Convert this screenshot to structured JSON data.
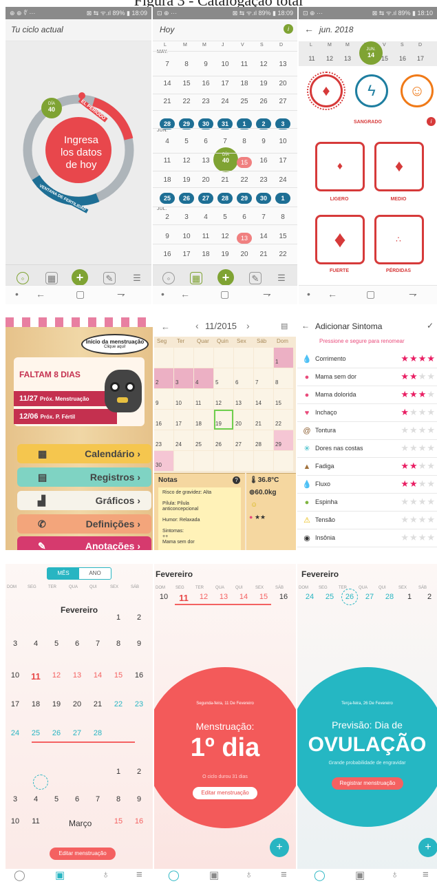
{
  "caption": "Figura 3 - Catalogação total",
  "p1": {
    "status_left": "⊕ ⊕ ∜ ···",
    "status_right": "⊠ ⇆ ᯤ.ıl 89% ▮ 18:09",
    "title": "Tu ciclo actual",
    "day_label": "DÍA",
    "day_num": "40",
    "periodo": "EL PERÍODO",
    "ventana": "VENTANA DE FERTILIDAD",
    "center_text": [
      "Ingresa",
      "los datos",
      "de hoy"
    ]
  },
  "p2": {
    "status_left": "⊡ ⊕ ···",
    "status_right": "⊠ ⇆ ᯤ.ıl 89% ▮ 18:09",
    "title": "Hoy",
    "weekdays": [
      "L",
      "M",
      "M",
      "J",
      "V",
      "S",
      "D"
    ],
    "month_may": "MAY.",
    "month_jun": "JUN.",
    "month_jul": "JUL.",
    "rows": [
      [
        "7",
        "8",
        "9",
        "10",
        "11",
        "12",
        "13"
      ],
      [
        "14",
        "15",
        "16",
        "17",
        "18",
        "19",
        "20"
      ],
      [
        "21",
        "22",
        "23",
        "24",
        "25",
        "26",
        "27"
      ],
      [
        "28",
        "29",
        "30",
        "31",
        "1",
        "2",
        "3"
      ],
      [
        "4",
        "5",
        "6",
        "7",
        "8",
        "9",
        "10"
      ],
      [
        "11",
        "12",
        "13",
        "40",
        "15",
        "16",
        "17"
      ],
      [
        "18",
        "19",
        "20",
        "21",
        "22",
        "23",
        "24"
      ],
      [
        "25",
        "26",
        "27",
        "28",
        "29",
        "30",
        "1"
      ],
      [
        "2",
        "3",
        "4",
        "5",
        "6",
        "7",
        "8"
      ],
      [
        "9",
        "10",
        "11",
        "12",
        "13",
        "14",
        "15"
      ],
      [
        "16",
        "17",
        "18",
        "19",
        "20",
        "21",
        "22"
      ]
    ],
    "dia_label": "DÍA",
    "jul_small": "JUL."
  },
  "p3": {
    "status_left": "⊡ ⊕ ···",
    "status_right": "⊠ ⇆ ᯤ.ıl 89% ▮ 18:10",
    "title": "jun. 2018",
    "weekdays": [
      "L",
      "M",
      "M",
      "J",
      "V",
      "S",
      "D"
    ],
    "days": [
      "11",
      "12",
      "13",
      "14",
      "15",
      "16",
      "17"
    ],
    "jun_label": "JUN.",
    "sangrado": "SANGRADO",
    "cards": [
      "LIGERO",
      "MEDIO",
      "FUERTE",
      "PÉRDIDAS"
    ]
  },
  "m1": {
    "bubble1": "Início da menstruação",
    "bubble2": "Clique aqui!",
    "faltam": "FALTAM 8 DIAS",
    "prox1_date": "11/27",
    "prox1_label": "Próx. Menstruação",
    "prox2_date": "12/06",
    "prox2_label": "Próx. P. Fértil",
    "menu": [
      "Calendário",
      "Registros",
      "Gráficos",
      "Definições",
      "Anotações"
    ]
  },
  "m2": {
    "month": "11/2015",
    "weekdays": [
      "Seg",
      "Ter",
      "Quar",
      "Quin",
      "Sex",
      "Sáb",
      "Dom"
    ],
    "rows": [
      [
        "",
        "",
        "",
        "",
        "",
        "",
        "1"
      ],
      [
        "2",
        "3",
        "4",
        "5",
        "6",
        "7",
        "8"
      ],
      [
        "9",
        "10",
        "11",
        "12",
        "13",
        "14",
        "15"
      ],
      [
        "16",
        "17",
        "18",
        "19",
        "20",
        "21",
        "22"
      ],
      [
        "23",
        "24",
        "25",
        "26",
        "27",
        "28",
        "29"
      ],
      [
        "30",
        "",
        "",
        "",
        "",
        "",
        ""
      ]
    ],
    "notas": "Notas",
    "temp": "36.8°C",
    "weight": "60.0kg",
    "stars": "★★",
    "note_lines": [
      "Risco de gravidez: Alta",
      "",
      "Pílula: Pílula",
      "anticoncepcional",
      "",
      "Humor: Relaxada",
      "",
      "Sintomas:",
      "++",
      "Mama sem dor"
    ]
  },
  "m3": {
    "title": "Adicionar Sintoma",
    "hint": "Pressione e segure para renomear",
    "items": [
      {
        "icon": "💧",
        "name": "Corrimento",
        "stars": 4
      },
      {
        "icon": "●",
        "name": "Mama sem dor",
        "stars": 2
      },
      {
        "icon": "●",
        "name": "Mama dolorida",
        "stars": 3
      },
      {
        "icon": "♥",
        "name": "Inchaço",
        "stars": 1
      },
      {
        "icon": "@",
        "name": "Tontura",
        "stars": 0
      },
      {
        "icon": "✳",
        "name": "Dores nas costas",
        "stars": 0
      },
      {
        "icon": "▲",
        "name": "Fadiga",
        "stars": 2
      },
      {
        "icon": "💧",
        "name": "Fluxo",
        "stars": 2
      },
      {
        "icon": "●",
        "name": "Espinha",
        "stars": 0
      },
      {
        "icon": "⚠",
        "name": "Tensão",
        "stars": 0
      },
      {
        "icon": "◉",
        "name": "Insônia",
        "stars": 0
      }
    ]
  },
  "b1": {
    "tab_mes": "MÊS",
    "tab_ano": "ANO",
    "weekdays": [
      "DOM",
      "SEG",
      "TER",
      "QUA",
      "QUI",
      "SEX",
      "SÁB"
    ],
    "month1": "Fevereiro",
    "month2": "Março",
    "edit_btn": "Editar menstruação",
    "rows1": [
      [
        "",
        "",
        "",
        "",
        "",
        "1",
        "2"
      ],
      [
        "3",
        "4",
        "5",
        "6",
        "7",
        "8",
        "9"
      ],
      [
        "10",
        "11",
        "12",
        "13",
        "14",
        "15",
        "16"
      ],
      [
        "17",
        "18",
        "19",
        "20",
        "21",
        "22",
        "23"
      ],
      [
        "24",
        "25",
        "26",
        "27",
        "28",
        "",
        ""
      ]
    ],
    "rows2": [
      [
        "",
        "",
        "",
        "",
        "",
        "1",
        "2"
      ],
      [
        "3",
        "4",
        "5",
        "6",
        "7",
        "8",
        "9"
      ],
      [
        "10",
        "11",
        "",
        "",
        "",
        "15",
        "16"
      ]
    ]
  },
  "b2": {
    "month": "Fevereiro",
    "weekdays": [
      "DOM",
      "SEG",
      "TER",
      "QUA",
      "QUI",
      "SEX",
      "SÁB"
    ],
    "week": [
      "10",
      "11",
      "12",
      "13",
      "14",
      "15",
      "16"
    ],
    "date": "Segunda-feira, 11 De Fevereiro",
    "label": "Menstruação:",
    "big": "1º dia",
    "sub": "O ciclo durou 31 dias",
    "button": "Editar menstruação"
  },
  "b3": {
    "month": "Fevereiro",
    "weekdays": [
      "DOM",
      "SEG",
      "TER",
      "QUA",
      "QUI",
      "SEX",
      "SÁB"
    ],
    "week": [
      "24",
      "25",
      "26",
      "27",
      "28",
      "1",
      "2"
    ],
    "date": "Terça-feira, 26 De Fevereiro",
    "label": "Previsão: Dia de",
    "big": "OVULAÇÃO",
    "sub": "Grande probabilidade de engravidar",
    "button": "Registrar menstruação"
  },
  "colors": {
    "green": "#7fa333",
    "red": "#e8474c",
    "blue": "#1e6f95",
    "teal": "#28b5c2",
    "coral": "#f46161",
    "pink": "#e94b7b"
  }
}
